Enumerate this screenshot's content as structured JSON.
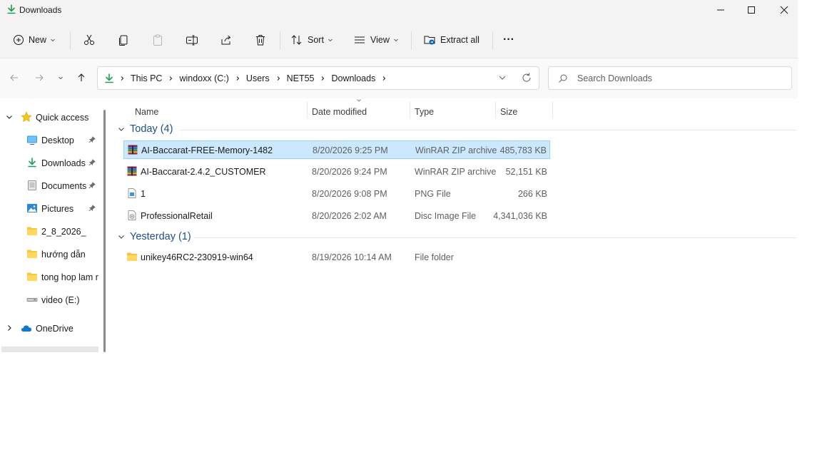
{
  "window": {
    "title": "Downloads"
  },
  "toolbar": {
    "new_label": "New",
    "sort_label": "Sort",
    "view_label": "View",
    "extract_label": "Extract all",
    "more_label": "···"
  },
  "address": {
    "crumbs": [
      "This PC",
      "windoxx (C:)",
      "Users",
      "NET55",
      "Downloads"
    ]
  },
  "search": {
    "placeholder": "Search Downloads"
  },
  "sidebar": {
    "quick_access": "Quick access",
    "items": [
      {
        "label": "Desktop",
        "icon": "desktop-icon",
        "pinned": true
      },
      {
        "label": "Downloads",
        "icon": "download-icon",
        "pinned": true
      },
      {
        "label": "Documents",
        "icon": "document-icon",
        "pinned": true
      },
      {
        "label": "Pictures",
        "icon": "pictures-icon",
        "pinned": true
      },
      {
        "label": "2_8_2026_",
        "icon": "folder-icon",
        "pinned": false
      },
      {
        "label": "hướng dẫn",
        "icon": "folder-icon",
        "pinned": false
      },
      {
        "label": "tong hop lam r",
        "icon": "folder-icon",
        "pinned": false
      },
      {
        "label": "video (E:)",
        "icon": "drive-icon",
        "pinned": false
      }
    ],
    "onedrive": "OneDrive"
  },
  "columns": {
    "name": "Name",
    "date": "Date modified",
    "type": "Type",
    "size": "Size"
  },
  "groups": [
    {
      "label": "Today (4)",
      "files": [
        {
          "name": "AI-Baccarat-FREE-Memory-1482",
          "date": "8/20/2026 9:25 PM",
          "type": "WinRAR ZIP archive",
          "size": "485,783 KB",
          "icon": "winrar-icon",
          "selected": true
        },
        {
          "name": "AI-Baccarat-2.4.2_CUSTOMER",
          "date": "8/20/2026 9:24 PM",
          "type": "WinRAR ZIP archive",
          "size": "52,151 KB",
          "icon": "winrar-icon",
          "selected": false
        },
        {
          "name": "1",
          "date": "8/20/2026 9:08 PM",
          "type": "PNG File",
          "size": "266 KB",
          "icon": "png-file-icon",
          "selected": false
        },
        {
          "name": "ProfessionalRetail",
          "date": "8/20/2026 2:02 AM",
          "type": "Disc Image File",
          "size": "4,341,036 KB",
          "icon": "disc-image-icon",
          "selected": false
        }
      ]
    },
    {
      "label": "Yesterday (1)",
      "files": [
        {
          "name": "unikey46RC2-230919-win64",
          "date": "8/19/2026 10:14 AM",
          "type": "File folder",
          "size": "",
          "icon": "folder-icon",
          "selected": false
        }
      ]
    }
  ],
  "colors": {
    "accent": "#0067c0",
    "selection": "#cce8ff",
    "group_text": "#1f4e8c",
    "folder": "#f3c744"
  }
}
